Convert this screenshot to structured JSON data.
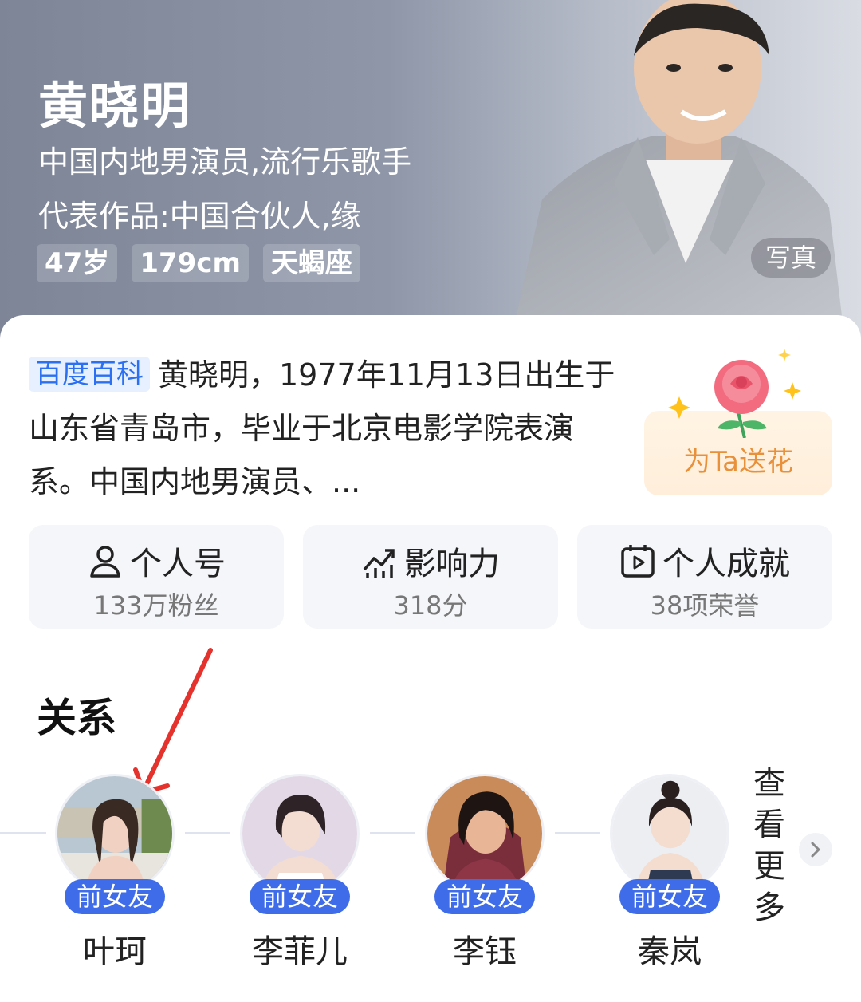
{
  "profile": {
    "name": "黄晓明",
    "subtitle_1": "中国内地男演员,流行乐歌手",
    "subtitle_2": "代表作品:中国合伙人,缘",
    "tags": [
      "47岁",
      "179cm",
      "天蝎座"
    ],
    "photo_button": "写真"
  },
  "summary": {
    "badge": "百度百科",
    "text": "黄晓明，1977年11月13日出生于山东省青岛市，毕业于北京电影学院表演系。中国内地男演员、..."
  },
  "flower": {
    "label": "为Ta送花"
  },
  "stats": [
    {
      "icon": "person-icon",
      "title": "个人号",
      "sub": "133万粉丝"
    },
    {
      "icon": "trend-chart-icon",
      "title": "影响力",
      "sub": "318分"
    },
    {
      "icon": "play-calendar-icon",
      "title": "个人成就",
      "sub": "38项荣誉"
    }
  ],
  "relations": {
    "title": "关系",
    "people": [
      {
        "name": "叶珂",
        "relation": "前女友"
      },
      {
        "name": "李菲儿",
        "relation": "前女友"
      },
      {
        "name": "李钰",
        "relation": "前女友"
      },
      {
        "name": "秦岚",
        "relation": "前女友"
      }
    ],
    "view_more": "查看更多"
  },
  "colors": {
    "accent_blue": "#3f6ce8",
    "annotation_red": "#e5322d",
    "flower_orange": "#e8913a"
  }
}
